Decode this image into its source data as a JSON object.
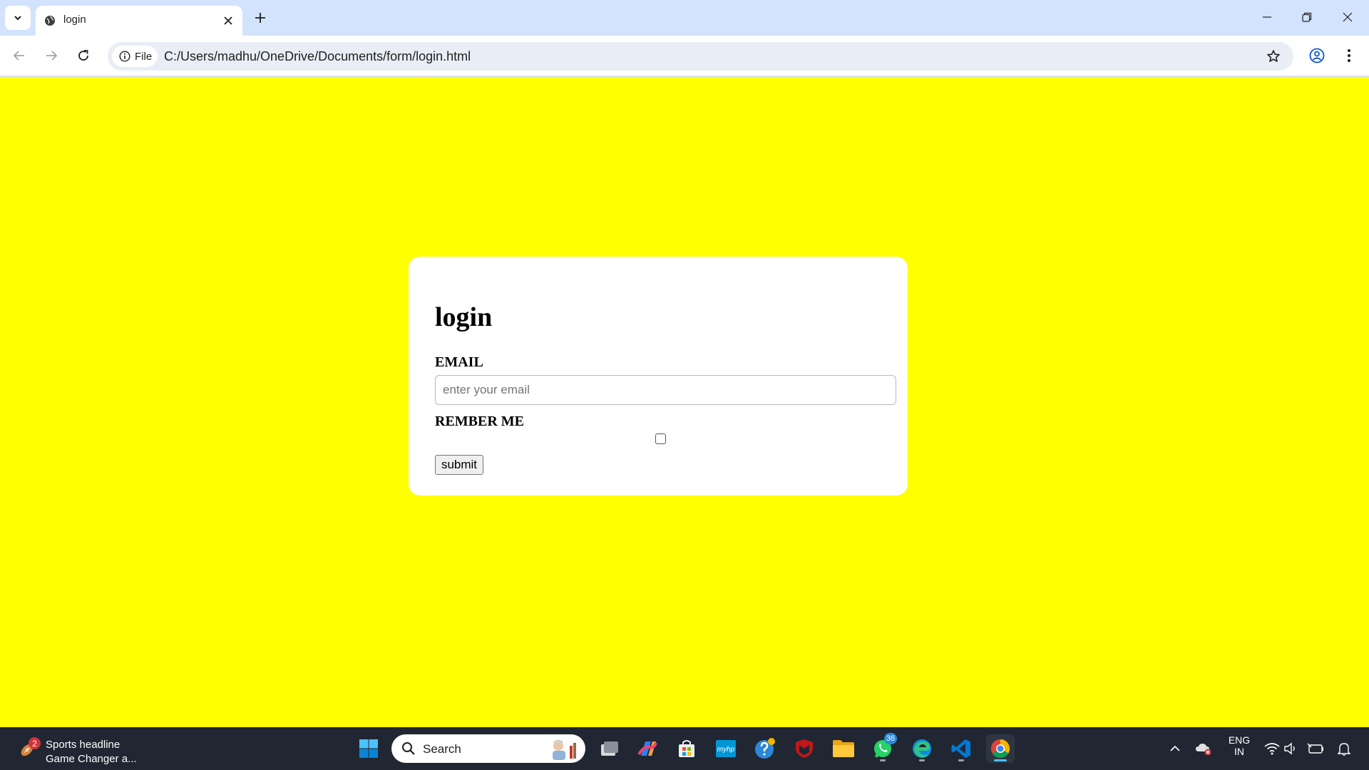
{
  "browser": {
    "tab_title": "login",
    "site_chip_label": "File",
    "url": "C:/Users/madhu/OneDrive/Documents/form/login.html"
  },
  "page": {
    "background_color": "#ffff00",
    "form_title": "login",
    "email_label": "EMAIL",
    "email_placeholder": "enter your email",
    "email_value": "",
    "remember_label": "REMBER ME",
    "remember_checked": false,
    "submit_label": "submit"
  },
  "taskbar": {
    "widget_badge": "2",
    "widget_title": "Sports headline",
    "widget_subtitle": "Game Changer a...",
    "search_label": "Search",
    "whatsapp_badge": "36",
    "language_line1": "ENG",
    "language_line2": "IN"
  }
}
